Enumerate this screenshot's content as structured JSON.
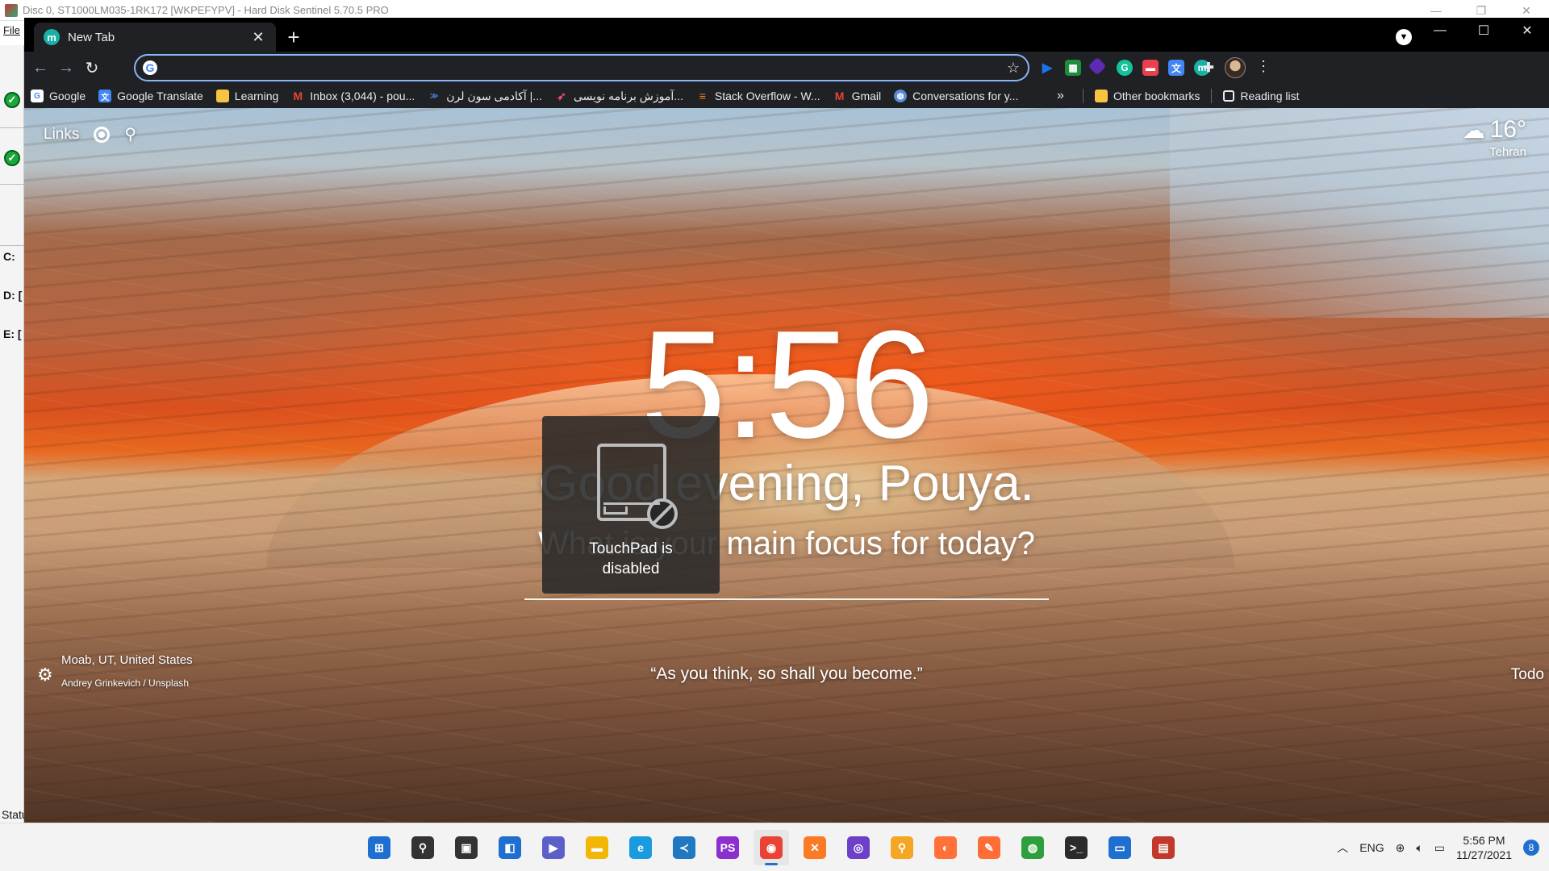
{
  "background_app": {
    "title": "Disc 0, ST1000LM035-1RK172 [WKPEFYPV]  -  Hard Disk Sentinel 5.70.5 PRO",
    "menu_file": "File",
    "drives": [
      "C:",
      "D: [",
      "E: ["
    ],
    "status_label": "Statu"
  },
  "chrome": {
    "tab": {
      "title": "New Tab",
      "favicon_letter": "m"
    },
    "omnibox": {
      "value": "",
      "placeholder": ""
    },
    "bookmarks": [
      {
        "label": "Google",
        "icon": "google-icon",
        "color": "#ffffff"
      },
      {
        "label": "Google Translate",
        "icon": "translate-icon",
        "color": "#4285f4"
      },
      {
        "label": "Learning",
        "icon": "folder-icon",
        "color": "#f6c343"
      },
      {
        "label": "Inbox (3,044) - pou...",
        "icon": "gmail-icon",
        "color": "#ea4335"
      },
      {
        "label": "آکادمی سون لرن |...",
        "icon": "sevenlearn-icon",
        "color": "#4a7bd8"
      },
      {
        "label": "آموزش برنامه نویسی...",
        "icon": "rocket-icon",
        "color": "#e84a6a"
      },
      {
        "label": "Stack Overflow - W...",
        "icon": "stackoverflow-icon",
        "color": "#f48024"
      },
      {
        "label": "Gmail",
        "icon": "gmail-icon",
        "color": "#ea4335"
      },
      {
        "label": "Conversations for y...",
        "icon": "globe-icon",
        "color": "#5c8bd6"
      }
    ],
    "bookmarks_more": "»",
    "other_bookmarks": "Other bookmarks",
    "reading_list": "Reading list"
  },
  "momentum": {
    "links_label": "Links",
    "weather": {
      "temp": "16°",
      "city": "Tehran"
    },
    "clock": "5:56",
    "greeting": "Good evening, Pouya.",
    "focus_question": "What is your main focus for today?",
    "location": "Moab, UT, United States",
    "photo_credit": "Andrey Grinkevich / Unsplash",
    "quote": "“As you think, so shall you become.”",
    "todo": "Todo"
  },
  "osd": {
    "line1": "TouchPad is",
    "line2": "disabled"
  },
  "taskbar": {
    "apps": [
      {
        "name": "start",
        "icon": "windows-icon",
        "color": "#1f6fd1",
        "glyph": "⊞"
      },
      {
        "name": "search",
        "icon": "search-icon",
        "color": "#333333",
        "glyph": "⚲"
      },
      {
        "name": "task-view",
        "icon": "taskview-icon",
        "color": "#333333",
        "glyph": "▣"
      },
      {
        "name": "widgets",
        "icon": "widgets-icon",
        "color": "#1f6fd1",
        "glyph": "◧"
      },
      {
        "name": "teams",
        "icon": "teams-icon",
        "color": "#5b5fc7",
        "glyph": "▶"
      },
      {
        "name": "explorer",
        "icon": "folder-icon",
        "color": "#f2b705",
        "glyph": "▬"
      },
      {
        "name": "edge",
        "icon": "edge-icon",
        "color": "#1a9be0",
        "glyph": "e"
      },
      {
        "name": "vscode",
        "icon": "vscode-icon",
        "color": "#1f78c1",
        "glyph": "≺"
      },
      {
        "name": "phpstorm",
        "icon": "phpstorm-icon",
        "color": "#8b2fcf",
        "glyph": "PS"
      },
      {
        "name": "chrome",
        "icon": "chrome-icon",
        "color": "#ea4335",
        "glyph": "◉",
        "active": true
      },
      {
        "name": "xampp",
        "icon": "xampp-icon",
        "color": "#fb7a24",
        "glyph": "✕"
      },
      {
        "name": "github-desktop",
        "icon": "github-icon",
        "color": "#6e40c9",
        "glyph": "◎"
      },
      {
        "name": "search-tool",
        "icon": "magnifier-icon",
        "color": "#f5a623",
        "glyph": "⚲"
      },
      {
        "name": "firefox",
        "icon": "firefox-icon",
        "color": "#ff7139",
        "glyph": "◐"
      },
      {
        "name": "postman",
        "icon": "postman-icon",
        "color": "#ff6c37",
        "glyph": "✎"
      },
      {
        "name": "network",
        "icon": "network-icon",
        "color": "#2e9e3f",
        "glyph": "◍"
      },
      {
        "name": "terminal",
        "icon": "terminal-icon",
        "color": "#2b2b2b",
        "glyph": ">_"
      },
      {
        "name": "remote",
        "icon": "window-icon",
        "color": "#1f6fd1",
        "glyph": "▭"
      },
      {
        "name": "hd-sentinel",
        "icon": "harddisk-icon",
        "color": "#c0392b",
        "glyph": "▤"
      }
    ],
    "tray": {
      "language": "ENG",
      "time": "5:56 PM",
      "date": "11/27/2021",
      "notifications": "8"
    }
  }
}
